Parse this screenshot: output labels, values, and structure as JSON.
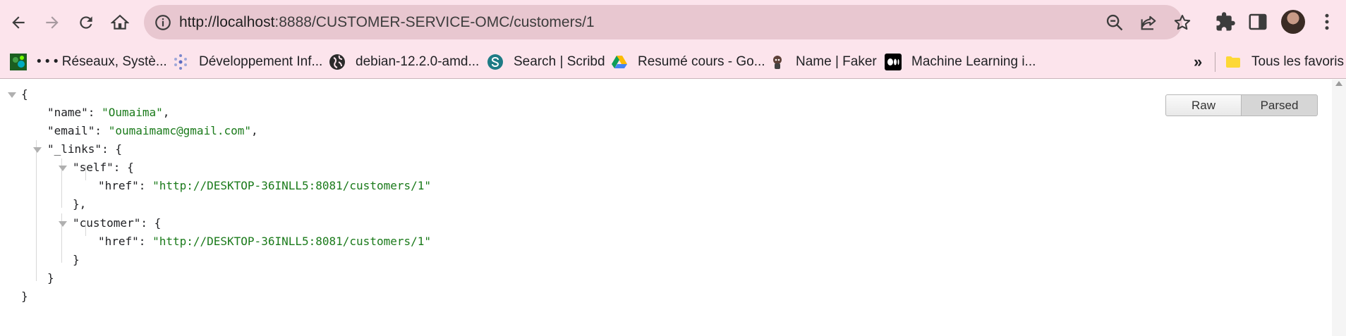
{
  "browser": {
    "url_host": "http://localhost",
    "url_rest": ":8888/CUSTOMER-SERVICE-OMC/customers/1"
  },
  "bookmarks": [
    {
      "label": "• • • Réseaux, Systè...",
      "icon": "colorful-network-icon"
    },
    {
      "label": "Développement Inf...",
      "icon": "network-dots-icon"
    },
    {
      "label": "debian-12.2.0-amd...",
      "icon": "globe-icon"
    },
    {
      "label": "Search | Scribd",
      "icon": "scribd-icon"
    },
    {
      "label": "Resumé cours - Go...",
      "icon": "google-drive-icon"
    },
    {
      "label": "Name | Faker",
      "icon": "faker-icon"
    },
    {
      "label": "Machine Learning i...",
      "icon": "medium-icon"
    }
  ],
  "bookmarks_more": "»",
  "all_bookmarks": "Tous les favoris",
  "viewer": {
    "raw_label": "Raw",
    "parsed_label": "Parsed",
    "lines": [
      "{",
      "\"name\": ",
      "\"Oumaima\"",
      "\"email\": ",
      "\"oumaimamc@gmail.com\"",
      "\"_links\": {",
      "\"self\": {",
      "\"href\": ",
      "\"http://DESKTOP-36INLL5:8081/customers/1\"",
      "},",
      "\"customer\": {",
      "\"href\": ",
      "\"http://DESKTOP-36INLL5:8081/customers/1\"",
      "}",
      "}",
      "}"
    ]
  }
}
